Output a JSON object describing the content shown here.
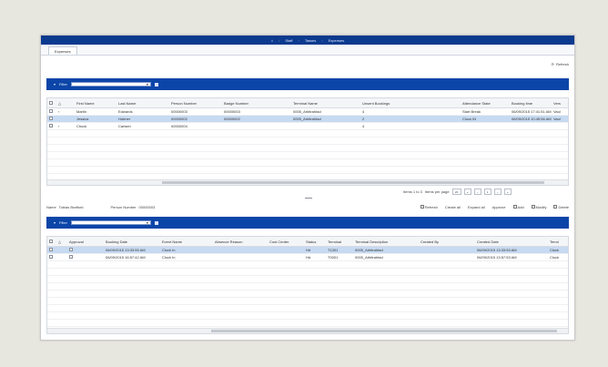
{
  "topbar": {
    "items": [
      "Staff",
      "Tasses",
      "Expenses"
    ]
  },
  "tabs": [
    {
      "label": "Expenses"
    }
  ],
  "toolbar": {
    "refresh_label": "Refresh"
  },
  "filter_top": {
    "label": "Filter"
  },
  "grid1": {
    "headers": [
      "First Name",
      "Last Name",
      "Person Number",
      "Badge Number",
      "Terminal Name",
      "Unsent Bookings",
      "Attendance State",
      "Booking time",
      "Vers"
    ],
    "rows": [
      {
        "cells": [
          "Martin",
          "Edwards",
          "00000003",
          "00000003",
          "0005_Arbitrahtad",
          "4",
          "Start Break",
          "06/09/2015 17:41:51 AM",
          "Vaul"
        ],
        "selected": false
      },
      {
        "cells": [
          "Jessica",
          "Hubner",
          "00000002",
          "00000002",
          "0005_Arbitrahtad",
          "2",
          "Clock IN",
          "06/09/2015 10:45:56 AM",
          "Vaul"
        ],
        "selected": true
      },
      {
        "cells": [
          "Chuck",
          "Carlsen",
          "00000004",
          "",
          "",
          "4",
          "",
          "",
          ""
        ],
        "selected": false
      }
    ]
  },
  "pager": {
    "items_text": "Items 1 to 3",
    "per_page_label": "Items per page",
    "per_page": "20",
    "page": "1"
  },
  "detail": {
    "name_label": "Name",
    "name_value": "Tobias Brafford",
    "person_label": "Person Number",
    "person_value": "00000003"
  },
  "actions": [
    "Refresh",
    "Create all",
    "Expand all",
    "Approve",
    "Add",
    "Modify",
    "Delete"
  ],
  "filter_bottom": {
    "label": "Filter"
  },
  "grid2": {
    "headers": [
      "Approval",
      "Booking Date",
      "Event Name",
      "Absence Reason",
      "Cost Center",
      "Status",
      "Terminal",
      "Terminal Description",
      "Created By",
      "Created Date",
      "Termi"
    ],
    "rows": [
      {
        "cells": [
          "",
          "06/09/2015 13:33:55 AM",
          "Clock In",
          "",
          "",
          "Hd",
          "T1301",
          "0005_Arbitrahtad",
          "",
          "06/09/2015 13:33:53 AM",
          "Clock"
        ],
        "selected": true
      },
      {
        "cells": [
          "",
          "06/09/2015 16:57:42 AM",
          "Clock In",
          "",
          "",
          "Hd",
          "T0001",
          "0005_Arbitrahtad",
          "",
          "06/09/2015 13:57:53 AM",
          "Clock"
        ],
        "selected": false
      }
    ]
  }
}
